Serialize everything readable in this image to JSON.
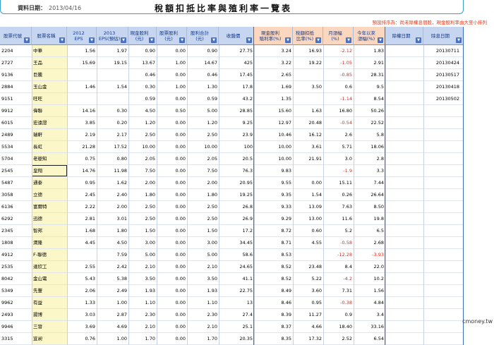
{
  "header": {
    "date_label": "資料日期：",
    "date_value": "2013/04/16",
    "title": "稅額扣抵比率與殖利率一覽表",
    "note": "預設排序為：尚未除權息個股，現金股利率由大至小排列"
  },
  "columns": [
    {
      "label": "股票代號",
      "w": 45,
      "style": "blue",
      "arrow": true
    },
    {
      "label": "股票名稱",
      "w": 50,
      "style": "blue",
      "arrow": true
    },
    {
      "label": "2012\nEPS",
      "w": 42,
      "style": "blue",
      "arrow": true
    },
    {
      "label": "2013\nEPS(預估)",
      "w": 45,
      "style": "blue",
      "arrow": true
    },
    {
      "label": "現金股利\n(元)",
      "w": 40,
      "style": "blue",
      "arrow": true
    },
    {
      "label": "股票股利\n(元)",
      "w": 43,
      "style": "blue",
      "arrow": true
    },
    {
      "label": "股利合計\n(元)",
      "w": 45,
      "style": "blue",
      "arrow": true
    },
    {
      "label": "收盤價",
      "w": 50,
      "style": "blue",
      "arrow": true
    },
    {
      "label": "現金股利\n殖利率(%)",
      "w": 55,
      "style": "orange",
      "arrow": true
    },
    {
      "label": "稅額扣抵\n比率(%)",
      "w": 43,
      "style": "orange",
      "arrow": true
    },
    {
      "label": "月漲幅\n(%)",
      "w": 43,
      "style": "orange",
      "arrow": true
    },
    {
      "label": "今年以來\n漲幅(%)",
      "w": 45,
      "style": "orange",
      "arrow": true
    },
    {
      "label": "除權日期",
      "w": 54,
      "style": "blue",
      "arrow": true
    },
    {
      "label": "除息日期",
      "w": 57,
      "style": "blue",
      "arrow": true
    }
  ],
  "rows": [
    [
      "2204",
      "中華",
      "1.56",
      "1.97",
      "0.90",
      "0.00",
      "0.90",
      "27.75",
      "3.24",
      "16.93",
      "-2.12",
      "1.83",
      "",
      "20130711"
    ],
    [
      "2727",
      "王品",
      "15.69",
      "19.15",
      "13.67",
      "1.00",
      "14.67",
      "425",
      "3.22",
      "19.22",
      "-1.05",
      "2.91",
      "",
      "20130424"
    ],
    [
      "9136",
      "巨騰",
      "",
      "",
      "0.46",
      "0.00",
      "0.46",
      "17.45",
      "2.65",
      "",
      "-0.85",
      "28.31",
      "",
      "20130517"
    ],
    [
      "2884",
      "玉山金",
      "1.46",
      "1.54",
      "0.30",
      "1.00",
      "1.30",
      "17.8",
      "1.69",
      "3.50",
      "0.6",
      "9.5",
      "",
      "20130418"
    ],
    [
      "9151",
      "旺旺",
      "",
      "",
      "0.59",
      "0.00",
      "0.59",
      "43.2",
      "1.35",
      "",
      "-1.14",
      "8.54",
      "",
      "20130502"
    ],
    [
      "9912",
      "偉聯",
      "14.16",
      "0.30",
      "4.50",
      "0.50",
      "5.00",
      "28.85",
      "15.60",
      "1.63",
      "16.80",
      "50.26",
      "",
      ""
    ],
    [
      "6015",
      "宏遠證",
      "3.85",
      "0.20",
      "1.20",
      "0.00",
      "1.20",
      "9.25",
      "12.97",
      "20.48",
      "-0.54",
      "22.52",
      "",
      ""
    ],
    [
      "2489",
      "瑞軒",
      "2.19",
      "2.17",
      "2.50",
      "0.00",
      "2.50",
      "23.9",
      "10.46",
      "16.12",
      "2.6",
      "5.8",
      "",
      ""
    ],
    [
      "5534",
      "長虹",
      "21.28",
      "17.52",
      "10.00",
      "0.00",
      "10.00",
      "100",
      "10.00",
      "3.61",
      "5.71",
      "18.06",
      "",
      ""
    ],
    [
      "5704",
      "老爺知",
      "0.75",
      "0.80",
      "2.05",
      "0.00",
      "2.05",
      "20.5",
      "10.00",
      "21.91",
      "3.0",
      "2.8",
      "",
      ""
    ],
    [
      "2545",
      "皇翔",
      "14.76",
      "11.98",
      "7.50",
      "0.00",
      "7.50",
      "76.3",
      "9.83",
      "",
      "-1.9",
      "3.3",
      "",
      ""
    ],
    [
      "5487",
      "通泰",
      "0.95",
      "1.62",
      "2.00",
      "0.00",
      "2.00",
      "20.95",
      "9.55",
      "0.00",
      "15.11",
      "7.44",
      "",
      ""
    ],
    [
      "3058",
      "立德",
      "2.45",
      "2.40",
      "1.80",
      "0.00",
      "1.80",
      "19.25",
      "9.35",
      "1.54",
      "0.26",
      "26.64",
      "",
      ""
    ],
    [
      "6136",
      "富爾特",
      "2.22",
      "2.00",
      "2.50",
      "0.00",
      "2.50",
      "26.8",
      "9.33",
      "13.09",
      "7.63",
      "8.50",
      "",
      ""
    ],
    [
      "6292",
      "迅德",
      "2.81",
      "3.01",
      "2.50",
      "0.00",
      "2.50",
      "26.9",
      "9.29",
      "13.00",
      "11.6",
      "19.8",
      "",
      ""
    ],
    [
      "2345",
      "智邦",
      "1.68",
      "1.80",
      "1.50",
      "0.00",
      "1.50",
      "17.2",
      "8.72",
      "0.60",
      "5.2",
      "6.5",
      "",
      ""
    ],
    [
      "1808",
      "潤隆",
      "4.45",
      "4.50",
      "3.00",
      "0.00",
      "3.00",
      "34.45",
      "8.71",
      "4.55",
      "-0.58",
      "2.68",
      "",
      ""
    ],
    [
      "4912",
      "F-聯德",
      "",
      "7.59",
      "5.00",
      "0.00",
      "5.00",
      "58.6",
      "8.53",
      "",
      "-12.28",
      "-3.93",
      "",
      ""
    ],
    [
      "2535",
      "達欣工",
      "2.55",
      "2.42",
      "2.10",
      "0.00",
      "2.10",
      "24.65",
      "8.52",
      "23.48",
      "8.4",
      "22.0",
      "",
      ""
    ],
    [
      "8042",
      "金山電",
      "5.43",
      "5.38",
      "3.50",
      "0.00",
      "3.50",
      "41.1",
      "8.52",
      "5.22",
      "-4.2",
      "10.2",
      "",
      ""
    ],
    [
      "5349",
      "先豐",
      "2.06",
      "2.49",
      "1.93",
      "0.00",
      "1.93",
      "22.75",
      "8.49",
      "3.60",
      "7.31",
      "1.56",
      "",
      ""
    ],
    [
      "9962",
      "有益",
      "1.33",
      "1.00",
      "1.10",
      "0.00",
      "1.10",
      "13",
      "8.46",
      "0.95",
      "-0.38",
      "4.84",
      "",
      ""
    ],
    [
      "2493",
      "揚博",
      "3.03",
      "2.87",
      "2.30",
      "0.00",
      "2.30",
      "27.4",
      "8.39",
      "11.27",
      "0.9",
      "3.4",
      "",
      ""
    ],
    [
      "9946",
      "三發",
      "3.69",
      "4.69",
      "2.10",
      "0.00",
      "2.10",
      "25.1",
      "8.37",
      "4.66",
      "18.40",
      "33.16",
      "",
      ""
    ],
    [
      "3315",
      "宣昶",
      "0.76",
      "1.00",
      "1.70",
      "0.00",
      "1.70",
      "20.35",
      "8.35",
      "17.32",
      "2.52",
      "6.54",
      "",
      ""
    ]
  ],
  "watermark": "cmoney.tw"
}
